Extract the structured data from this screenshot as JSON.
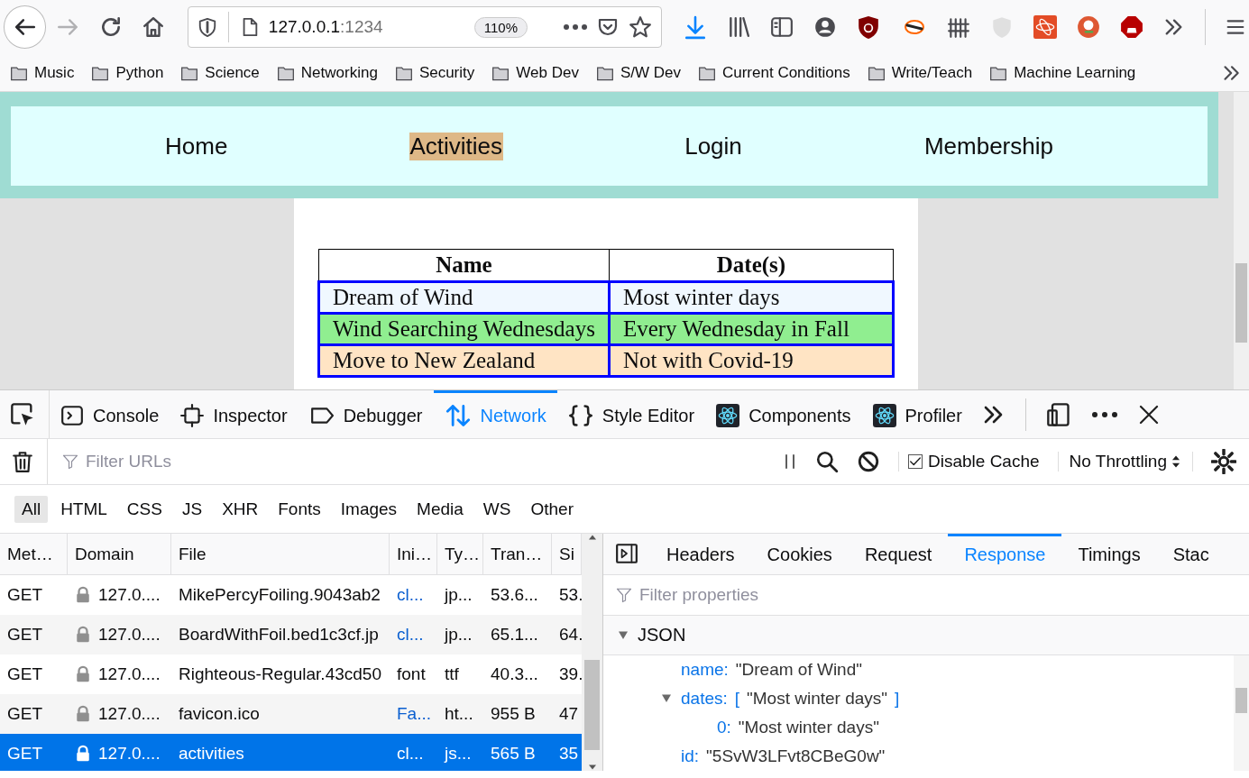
{
  "browser": {
    "forward_enabled": false,
    "url_host": "127.0.0.1",
    "url_port": ":1234",
    "zoom": "110%"
  },
  "bookmarks": [
    "Music",
    "Python",
    "Science",
    "Networking",
    "Security",
    "Web Dev",
    "S/W Dev",
    "Current Conditions",
    "Write/Teach",
    "Machine Learning"
  ],
  "site_nav": [
    {
      "label": "Home",
      "selected": false
    },
    {
      "label": "Activities",
      "selected": true
    },
    {
      "label": "Login",
      "selected": false
    },
    {
      "label": "Membership",
      "selected": false
    }
  ],
  "schedule": {
    "columns": [
      "Name",
      "Date(s)"
    ],
    "rows": [
      {
        "name": "Dream of Wind",
        "dates": "Most winter days",
        "color": "#f0f8ff"
      },
      {
        "name": "Wind Searching Wednesdays",
        "dates": "Every Wednesday in Fall",
        "color": "#90ee90"
      },
      {
        "name": "Move to New Zealand",
        "dates": "Not with Covid-19",
        "color": "#ffe4c4"
      }
    ]
  },
  "devtools": {
    "tabs": [
      {
        "label": "Console",
        "selected": false
      },
      {
        "label": "Inspector",
        "selected": false
      },
      {
        "label": "Debugger",
        "selected": false
      },
      {
        "label": "Network",
        "selected": true
      },
      {
        "label": "Style Editor",
        "selected": false
      },
      {
        "label": "Components",
        "selected": false
      },
      {
        "label": "Profiler",
        "selected": false
      }
    ],
    "filter_placeholder": "Filter URLs",
    "disable_cache": {
      "label": "Disable Cache",
      "checked": true
    },
    "throttling": "No Throttling",
    "type_filters": [
      {
        "label": "All",
        "selected": true
      },
      {
        "label": "HTML",
        "selected": false
      },
      {
        "label": "CSS",
        "selected": false
      },
      {
        "label": "JS",
        "selected": false
      },
      {
        "label": "XHR",
        "selected": false
      },
      {
        "label": "Fonts",
        "selected": false
      },
      {
        "label": "Images",
        "selected": false
      },
      {
        "label": "Media",
        "selected": false
      },
      {
        "label": "WS",
        "selected": false
      },
      {
        "label": "Other",
        "selected": false
      }
    ]
  },
  "requests": {
    "columns": [
      "Met…",
      "Domain",
      "File",
      "Ini…",
      "Ty…",
      "Tran…",
      "Si"
    ],
    "rows": [
      {
        "method": "GET",
        "domain": "127.0....",
        "file": "MikePercyFoiling.9043ab2",
        "initiator": "cl...",
        "initiator_link": true,
        "type": "jp...",
        "transferred": "53.6...",
        "size": "53.",
        "selected": false
      },
      {
        "method": "GET",
        "domain": "127.0....",
        "file": "BoardWithFoil.bed1c3cf.jp",
        "initiator": "cl...",
        "initiator_link": true,
        "type": "jp...",
        "transferred": "65.1...",
        "size": "64.",
        "selected": false
      },
      {
        "method": "GET",
        "domain": "127.0....",
        "file": "Righteous-Regular.43cd50",
        "initiator": "font",
        "initiator_link": false,
        "type": "ttf",
        "transferred": "40.3...",
        "size": "39.",
        "selected": false
      },
      {
        "method": "GET",
        "domain": "127.0....",
        "file": "favicon.ico",
        "initiator": "Fa...",
        "initiator_link": true,
        "type": "ht...",
        "transferred": "955 B",
        "size": "47",
        "selected": false
      },
      {
        "method": "GET",
        "domain": "127.0....",
        "file": "activities",
        "initiator": "cl...",
        "initiator_link": true,
        "type": "js...",
        "transferred": "565 B",
        "size": "35",
        "selected": true
      }
    ]
  },
  "details": {
    "tabs": [
      {
        "label": "Headers",
        "selected": false
      },
      {
        "label": "Cookies",
        "selected": false
      },
      {
        "label": "Request",
        "selected": false
      },
      {
        "label": "Response",
        "selected": true
      },
      {
        "label": "Timings",
        "selected": false
      },
      {
        "label": "Stac",
        "selected": false
      }
    ],
    "filter_placeholder": "Filter properties",
    "section": {
      "label": "JSON",
      "expanded": true
    },
    "tree": [
      {
        "key": "name:",
        "value": "\"Dream of Wind\""
      },
      {
        "key": "dates:",
        "open": "[",
        "value": "\"Most winter days\"",
        "close": "]",
        "expanded": true,
        "children": [
          {
            "key": "0:",
            "value": "\"Most winter days\""
          }
        ]
      },
      {
        "key": "id:",
        "value": "\"5SvW3LFvt8CBeG0w\""
      }
    ]
  }
}
